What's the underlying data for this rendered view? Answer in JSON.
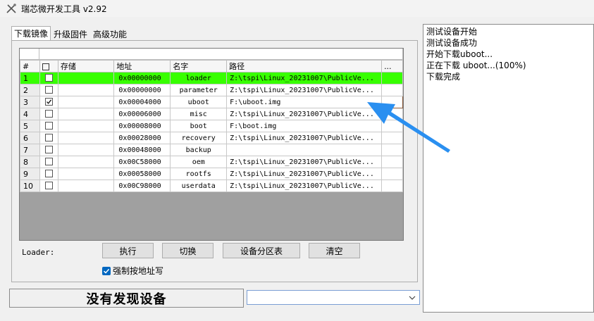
{
  "window": {
    "title": "瑞芯微开发工具 v2.92"
  },
  "tabs": [
    {
      "label": "下载镜像",
      "active": true
    },
    {
      "label": "升级固件",
      "active": false
    },
    {
      "label": "高级功能",
      "active": false
    }
  ],
  "table": {
    "headers": {
      "num": "#",
      "check": "",
      "storage": "存储",
      "address": "地址",
      "name": "名字",
      "path": "路径",
      "dots": "..."
    },
    "rows": [
      {
        "num": "1",
        "checked": false,
        "address": "0x00000000",
        "name": "loader",
        "path": "Z:\\tspi\\Linux_20231007\\PublicVe...",
        "selected": true
      },
      {
        "num": "2",
        "checked": false,
        "address": "0x00000000",
        "name": "parameter",
        "path": "Z:\\tspi\\Linux_20231007\\PublicVe...",
        "selected": false
      },
      {
        "num": "3",
        "checked": true,
        "address": "0x00004000",
        "name": "uboot",
        "path": "F:\\uboot.img",
        "selected": false
      },
      {
        "num": "4",
        "checked": false,
        "address": "0x00006000",
        "name": "misc",
        "path": "Z:\\tspi\\Linux_20231007\\PublicVe...",
        "selected": false
      },
      {
        "num": "5",
        "checked": false,
        "address": "0x00008000",
        "name": "boot",
        "path": "F:\\boot.img",
        "selected": false
      },
      {
        "num": "6",
        "checked": false,
        "address": "0x00028000",
        "name": "recovery",
        "path": "Z:\\tspi\\Linux_20231007\\PublicVe...",
        "selected": false
      },
      {
        "num": "7",
        "checked": false,
        "address": "0x00048000",
        "name": "backup",
        "path": "",
        "selected": false
      },
      {
        "num": "8",
        "checked": false,
        "address": "0x00C58000",
        "name": "oem",
        "path": "Z:\\tspi\\Linux_20231007\\PublicVe...",
        "selected": false
      },
      {
        "num": "9",
        "checked": false,
        "address": "0x00058000",
        "name": "rootfs",
        "path": "Z:\\tspi\\Linux_20231007\\PublicVe...",
        "selected": false
      },
      {
        "num": "10",
        "checked": false,
        "address": "0x00C98000",
        "name": "userdata",
        "path": "Z:\\tspi\\Linux_20231007\\PublicVe...",
        "selected": false
      }
    ]
  },
  "loader_label": "Loader:",
  "buttons": {
    "run": "执行",
    "switch": "切换",
    "partition_table": "设备分区表",
    "clear": "清空"
  },
  "force_addr": {
    "label": "强制按地址写",
    "checked": true
  },
  "status": {
    "text": "没有发现设备"
  },
  "device_combo": {
    "value": ""
  },
  "log": [
    "测试设备开始",
    "测试设备成功",
    "开始下载uboot...",
    "正在下载 uboot...(100%)",
    "下载完成"
  ],
  "colors": {
    "selected_row": "#37ff00",
    "annotation_arrow": "#2a8ff0",
    "checkbox_accent": "#0067c0"
  }
}
